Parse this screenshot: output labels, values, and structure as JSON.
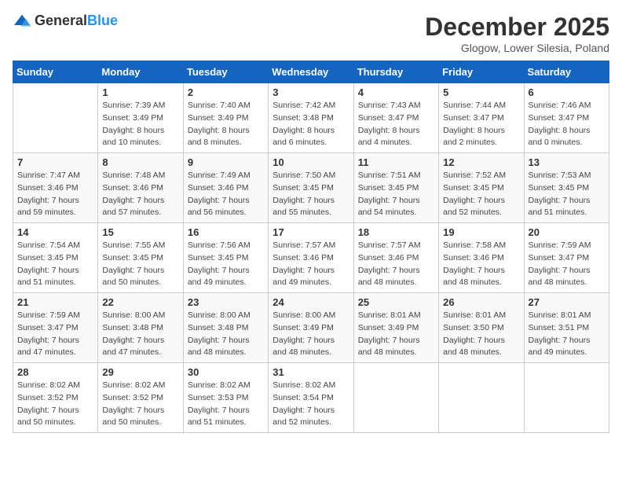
{
  "header": {
    "logo": {
      "general": "General",
      "blue": "Blue"
    },
    "title": "December 2025",
    "location": "Glogow, Lower Silesia, Poland"
  },
  "calendar": {
    "days_of_week": [
      "Sunday",
      "Monday",
      "Tuesday",
      "Wednesday",
      "Thursday",
      "Friday",
      "Saturday"
    ],
    "weeks": [
      [
        {
          "day": "",
          "sunrise": "",
          "sunset": "",
          "daylight": ""
        },
        {
          "day": "1",
          "sunrise": "Sunrise: 7:39 AM",
          "sunset": "Sunset: 3:49 PM",
          "daylight": "Daylight: 8 hours and 10 minutes."
        },
        {
          "day": "2",
          "sunrise": "Sunrise: 7:40 AM",
          "sunset": "Sunset: 3:49 PM",
          "daylight": "Daylight: 8 hours and 8 minutes."
        },
        {
          "day": "3",
          "sunrise": "Sunrise: 7:42 AM",
          "sunset": "Sunset: 3:48 PM",
          "daylight": "Daylight: 8 hours and 6 minutes."
        },
        {
          "day": "4",
          "sunrise": "Sunrise: 7:43 AM",
          "sunset": "Sunset: 3:47 PM",
          "daylight": "Daylight: 8 hours and 4 minutes."
        },
        {
          "day": "5",
          "sunrise": "Sunrise: 7:44 AM",
          "sunset": "Sunset: 3:47 PM",
          "daylight": "Daylight: 8 hours and 2 minutes."
        },
        {
          "day": "6",
          "sunrise": "Sunrise: 7:46 AM",
          "sunset": "Sunset: 3:47 PM",
          "daylight": "Daylight: 8 hours and 0 minutes."
        }
      ],
      [
        {
          "day": "7",
          "sunrise": "Sunrise: 7:47 AM",
          "sunset": "Sunset: 3:46 PM",
          "daylight": "Daylight: 7 hours and 59 minutes."
        },
        {
          "day": "8",
          "sunrise": "Sunrise: 7:48 AM",
          "sunset": "Sunset: 3:46 PM",
          "daylight": "Daylight: 7 hours and 57 minutes."
        },
        {
          "day": "9",
          "sunrise": "Sunrise: 7:49 AM",
          "sunset": "Sunset: 3:46 PM",
          "daylight": "Daylight: 7 hours and 56 minutes."
        },
        {
          "day": "10",
          "sunrise": "Sunrise: 7:50 AM",
          "sunset": "Sunset: 3:45 PM",
          "daylight": "Daylight: 7 hours and 55 minutes."
        },
        {
          "day": "11",
          "sunrise": "Sunrise: 7:51 AM",
          "sunset": "Sunset: 3:45 PM",
          "daylight": "Daylight: 7 hours and 54 minutes."
        },
        {
          "day": "12",
          "sunrise": "Sunrise: 7:52 AM",
          "sunset": "Sunset: 3:45 PM",
          "daylight": "Daylight: 7 hours and 52 minutes."
        },
        {
          "day": "13",
          "sunrise": "Sunrise: 7:53 AM",
          "sunset": "Sunset: 3:45 PM",
          "daylight": "Daylight: 7 hours and 51 minutes."
        }
      ],
      [
        {
          "day": "14",
          "sunrise": "Sunrise: 7:54 AM",
          "sunset": "Sunset: 3:45 PM",
          "daylight": "Daylight: 7 hours and 51 minutes."
        },
        {
          "day": "15",
          "sunrise": "Sunrise: 7:55 AM",
          "sunset": "Sunset: 3:45 PM",
          "daylight": "Daylight: 7 hours and 50 minutes."
        },
        {
          "day": "16",
          "sunrise": "Sunrise: 7:56 AM",
          "sunset": "Sunset: 3:45 PM",
          "daylight": "Daylight: 7 hours and 49 minutes."
        },
        {
          "day": "17",
          "sunrise": "Sunrise: 7:57 AM",
          "sunset": "Sunset: 3:46 PM",
          "daylight": "Daylight: 7 hours and 49 minutes."
        },
        {
          "day": "18",
          "sunrise": "Sunrise: 7:57 AM",
          "sunset": "Sunset: 3:46 PM",
          "daylight": "Daylight: 7 hours and 48 minutes."
        },
        {
          "day": "19",
          "sunrise": "Sunrise: 7:58 AM",
          "sunset": "Sunset: 3:46 PM",
          "daylight": "Daylight: 7 hours and 48 minutes."
        },
        {
          "day": "20",
          "sunrise": "Sunrise: 7:59 AM",
          "sunset": "Sunset: 3:47 PM",
          "daylight": "Daylight: 7 hours and 48 minutes."
        }
      ],
      [
        {
          "day": "21",
          "sunrise": "Sunrise: 7:59 AM",
          "sunset": "Sunset: 3:47 PM",
          "daylight": "Daylight: 7 hours and 47 minutes."
        },
        {
          "day": "22",
          "sunrise": "Sunrise: 8:00 AM",
          "sunset": "Sunset: 3:48 PM",
          "daylight": "Daylight: 7 hours and 47 minutes."
        },
        {
          "day": "23",
          "sunrise": "Sunrise: 8:00 AM",
          "sunset": "Sunset: 3:48 PM",
          "daylight": "Daylight: 7 hours and 48 minutes."
        },
        {
          "day": "24",
          "sunrise": "Sunrise: 8:00 AM",
          "sunset": "Sunset: 3:49 PM",
          "daylight": "Daylight: 7 hours and 48 minutes."
        },
        {
          "day": "25",
          "sunrise": "Sunrise: 8:01 AM",
          "sunset": "Sunset: 3:49 PM",
          "daylight": "Daylight: 7 hours and 48 minutes."
        },
        {
          "day": "26",
          "sunrise": "Sunrise: 8:01 AM",
          "sunset": "Sunset: 3:50 PM",
          "daylight": "Daylight: 7 hours and 48 minutes."
        },
        {
          "day": "27",
          "sunrise": "Sunrise: 8:01 AM",
          "sunset": "Sunset: 3:51 PM",
          "daylight": "Daylight: 7 hours and 49 minutes."
        }
      ],
      [
        {
          "day": "28",
          "sunrise": "Sunrise: 8:02 AM",
          "sunset": "Sunset: 3:52 PM",
          "daylight": "Daylight: 7 hours and 50 minutes."
        },
        {
          "day": "29",
          "sunrise": "Sunrise: 8:02 AM",
          "sunset": "Sunset: 3:52 PM",
          "daylight": "Daylight: 7 hours and 50 minutes."
        },
        {
          "day": "30",
          "sunrise": "Sunrise: 8:02 AM",
          "sunset": "Sunset: 3:53 PM",
          "daylight": "Daylight: 7 hours and 51 minutes."
        },
        {
          "day": "31",
          "sunrise": "Sunrise: 8:02 AM",
          "sunset": "Sunset: 3:54 PM",
          "daylight": "Daylight: 7 hours and 52 minutes."
        },
        {
          "day": "",
          "sunrise": "",
          "sunset": "",
          "daylight": ""
        },
        {
          "day": "",
          "sunrise": "",
          "sunset": "",
          "daylight": ""
        },
        {
          "day": "",
          "sunrise": "",
          "sunset": "",
          "daylight": ""
        }
      ]
    ]
  }
}
